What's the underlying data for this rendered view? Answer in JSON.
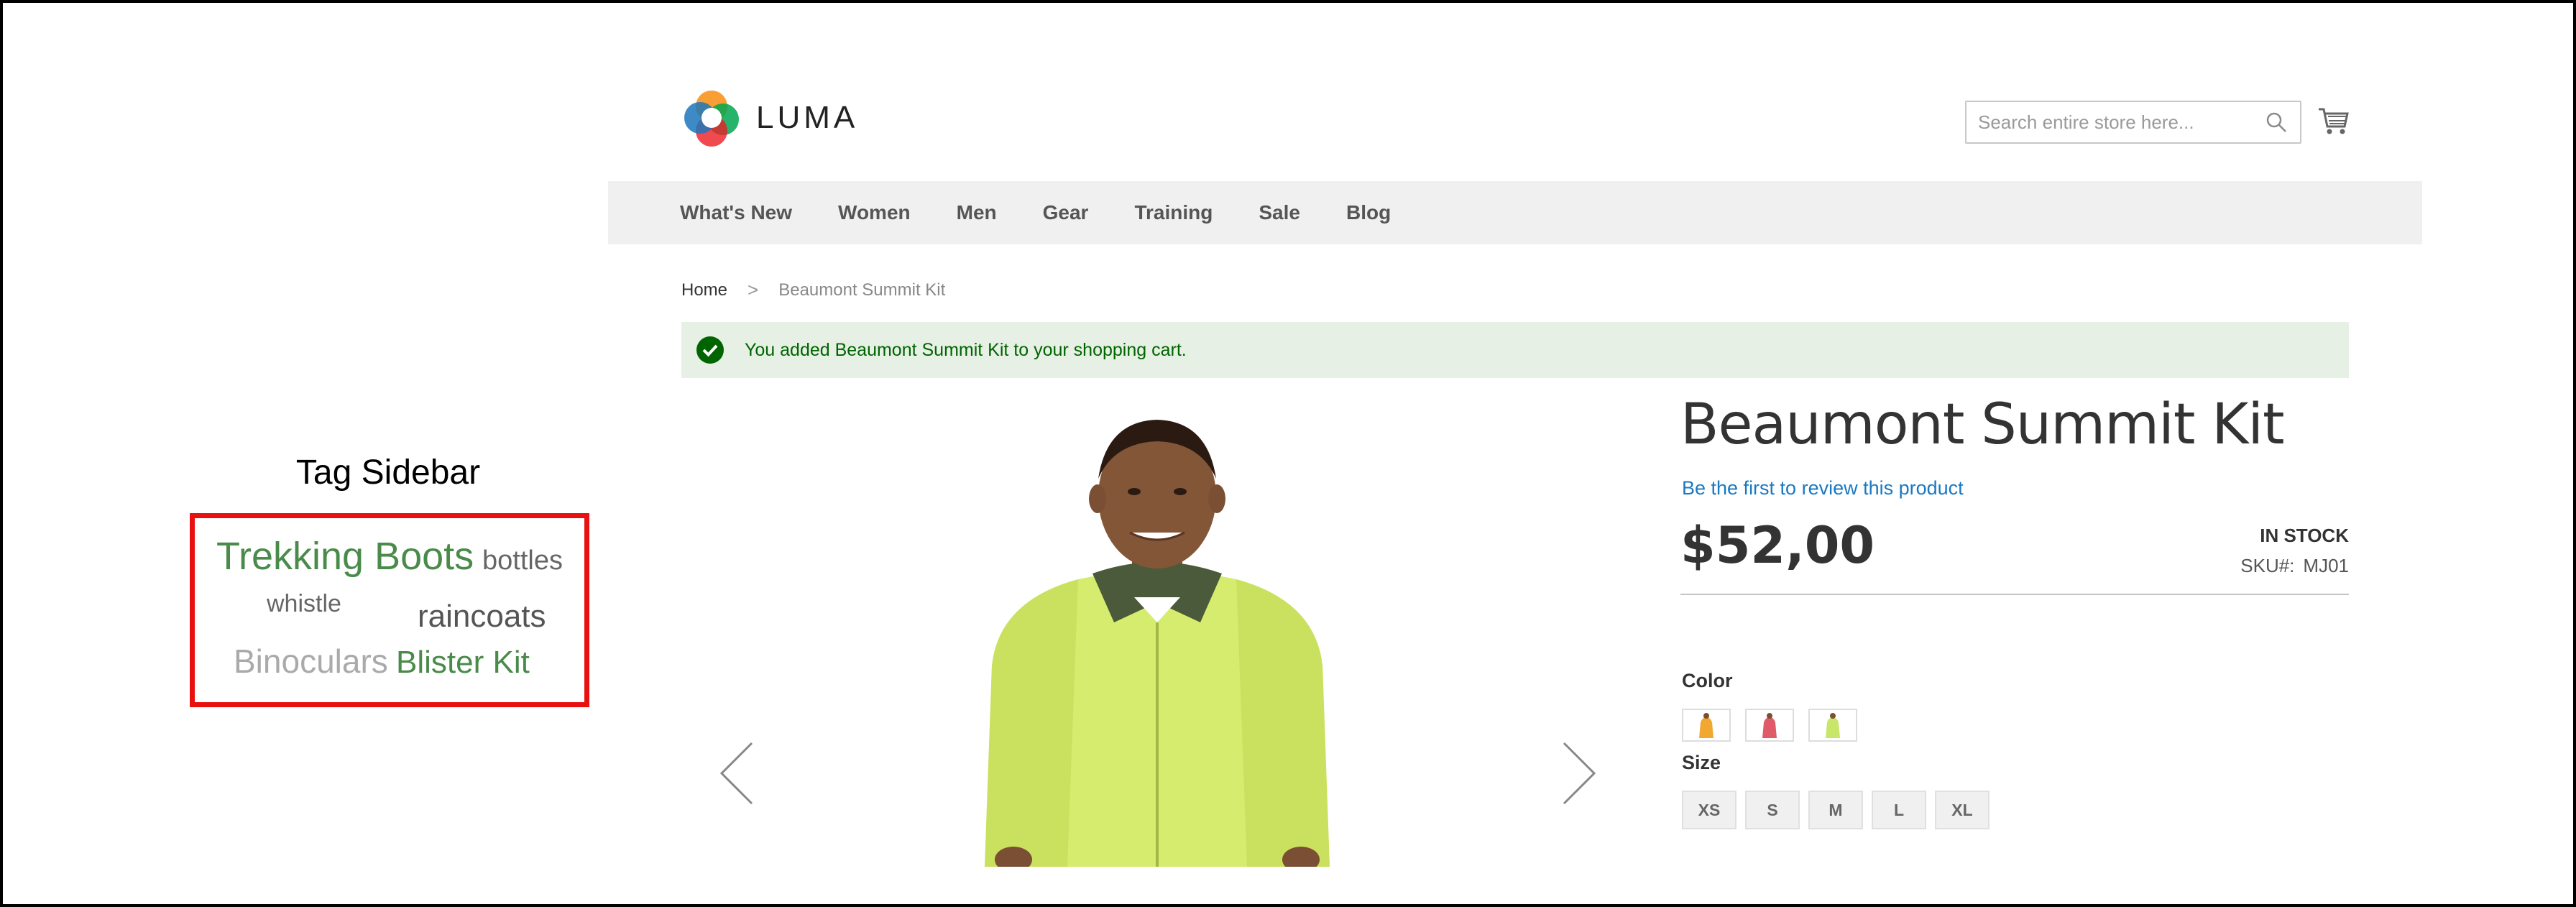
{
  "annotation": {
    "title": "Tag Sidebar",
    "tags": [
      "Trekking Boots",
      "bottles",
      "whistle",
      "raincoats",
      "Binoculars",
      "Blister Kit"
    ]
  },
  "header": {
    "logo_text": "LUMA",
    "search_placeholder": "Search entire store here...",
    "cart_icon": "cart-icon",
    "search_icon": "search-icon"
  },
  "nav": {
    "items": [
      "What's New",
      "Women",
      "Men",
      "Gear",
      "Training",
      "Sale",
      "Blog"
    ]
  },
  "breadcrumb": {
    "home": "Home",
    "separator": ">",
    "current": "Beaumont Summit Kit"
  },
  "message": {
    "text": "You added Beaumont Summit Kit to your shopping cart."
  },
  "product": {
    "title": "Beaumont Summit Kit",
    "review_link": "Be the first to review this product",
    "price": "$52,00",
    "stock": "IN STOCK",
    "sku_label": "SKU#:",
    "sku_value": "MJ01",
    "color_label": "Color",
    "size_label": "Size",
    "colors": [
      "#f0a830",
      "#e05a6a",
      "#c8e66a"
    ],
    "sizes": [
      "XS",
      "S",
      "M",
      "L",
      "XL"
    ]
  },
  "colors": {
    "accent_link": "#1979c3",
    "success_bg": "#e6f0e4",
    "success_text": "#006400",
    "annotation_border": "#e8110f",
    "tag_green": "#4a8a4a"
  }
}
